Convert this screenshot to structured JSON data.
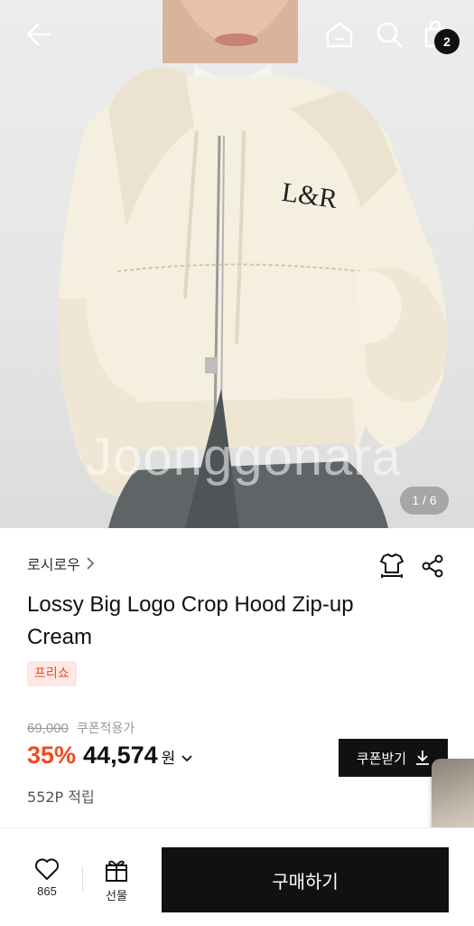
{
  "header": {
    "back_icon": "arrow-left-icon",
    "home_icon": "home-icon",
    "search_icon": "search-icon",
    "cart_icon": "shopping-bag-icon",
    "cart_count": "2"
  },
  "gallery": {
    "watermark": "Joonggonara",
    "counter": "1 / 6",
    "logo_text": "L&R"
  },
  "product": {
    "brand": "로시로우",
    "title": "Lossy Big Logo Crop Hood Zip-up Cream",
    "tag": "프리쇼",
    "original_price": "69,000",
    "coupon_note": "쿠폰적용가",
    "discount": "35%",
    "price": "44,574",
    "currency": "원",
    "points": "552P 적립",
    "coupon_button": "쿠폰받기"
  },
  "bottom_bar": {
    "like_count": "865",
    "gift_label": "선물",
    "buy_label": "구매하기"
  },
  "colors": {
    "accent": "#f24a1d",
    "tag_bg": "#fde8e3",
    "primary": "#111111"
  }
}
